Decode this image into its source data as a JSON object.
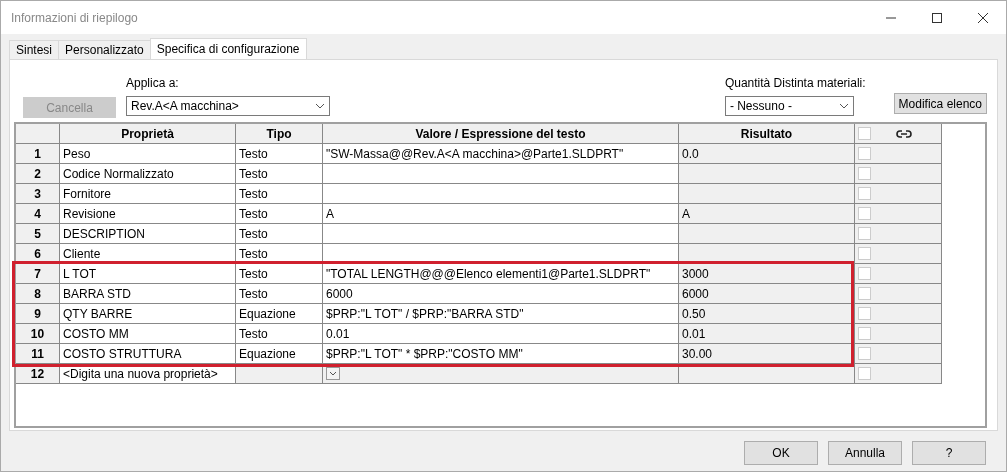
{
  "window": {
    "title": "Informazioni di riepilogo"
  },
  "tabs": [
    {
      "label": "Sintesi",
      "selected": false
    },
    {
      "label": "Personalizzato",
      "selected": false
    },
    {
      "label": "Specifica di configurazione",
      "selected": true
    }
  ],
  "cancel_button": {
    "label": "Cancella",
    "disabled": true
  },
  "apply_to": {
    "label": "Applica a:",
    "value": "Rev.A<A macchina>"
  },
  "bom_quantity": {
    "label": "Quantità Distinta materiali:",
    "value": "- Nessuno -"
  },
  "edit_list_button": {
    "label": "Modifica elenco"
  },
  "table": {
    "columns": [
      "Proprietà",
      "Tipo",
      "Valore / Espressione del testo",
      "Risultato"
    ],
    "header_checked": false,
    "rows": [
      {
        "number": "1",
        "property": "Peso",
        "type": "Testo",
        "value": "\"SW-Massa@@Rev.A<A macchina>@Parte1.SLDPRT\"",
        "result": "0.0",
        "checked": false
      },
      {
        "number": "2",
        "property": "Codice Normalizzato",
        "type": "Testo",
        "checked": false
      },
      {
        "number": "3",
        "property": "Fornitore",
        "type": "Testo",
        "checked": false
      },
      {
        "number": "4",
        "property": "Revisione",
        "type": "Testo",
        "value": "A",
        "result": "A",
        "checked": false
      },
      {
        "number": "5",
        "property": "DESCRIPTION",
        "type": "Testo",
        "checked": false
      },
      {
        "number": "6",
        "property": "Cliente",
        "type": "Testo",
        "checked": false
      },
      {
        "number": "7",
        "property": "L TOT",
        "type": "Testo",
        "value": "\"TOTAL LENGTH@@@Elenco elementi1@Parte1.SLDPRT\"",
        "result": "3000",
        "checked": false,
        "highlighted": true
      },
      {
        "number": "8",
        "property": "BARRA STD",
        "type": "Testo",
        "value": "6000",
        "result": "6000",
        "checked": false,
        "highlighted": true
      },
      {
        "number": "9",
        "property": "QTY BARRE",
        "type": "Equazione",
        "value": "$PRP:\"L TOT\" / $PRP:\"BARRA STD\"",
        "result": "0.50",
        "checked": false,
        "highlighted": true
      },
      {
        "number": "10",
        "property": "COSTO MM",
        "type": "Testo",
        "value": "0.01",
        "result": "0.01",
        "checked": false,
        "highlighted": true
      },
      {
        "number": "11",
        "property": "COSTO STRUTTURA",
        "type": "Equazione",
        "value": "$PRP:\"L TOT\" * $PRP:\"COSTO MM\"",
        "result": "30.00",
        "checked": false,
        "highlighted": true
      },
      {
        "number": "12",
        "property": "<Digita una nuova proprietà>",
        "kind": "new",
        "checked": false
      }
    ],
    "highlight_frame": true
  },
  "buttons": [
    "OK",
    "Annulla",
    "?"
  ]
}
